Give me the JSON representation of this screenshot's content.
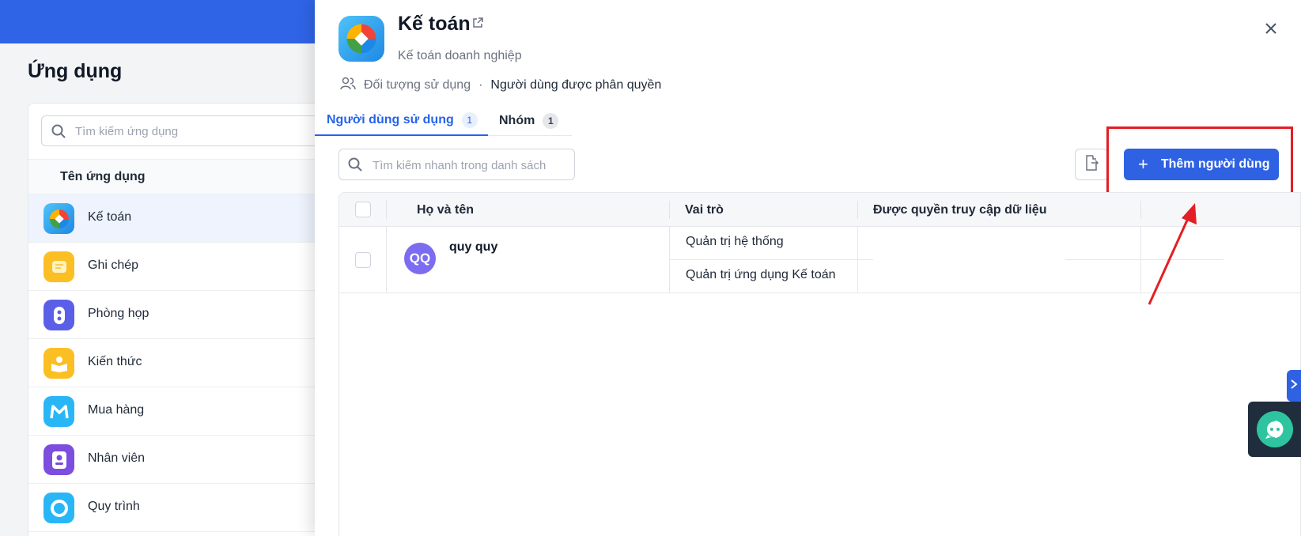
{
  "background_page": {
    "title": "Ứng dụng",
    "search_placeholder": "Tìm kiếm ứng dụng",
    "column_header": "Tên ứng dụng",
    "apps": [
      {
        "label": "Kế toán",
        "icon": "accounting-icon",
        "color": "#2196f3",
        "selected": true
      },
      {
        "label": "Ghi chép",
        "icon": "notes-icon",
        "color": "#fbbf24"
      },
      {
        "label": "Phòng họp",
        "icon": "meeting-room-icon",
        "color": "#5b5fe8"
      },
      {
        "label": "Kiến thức",
        "icon": "knowledge-icon",
        "color": "#fbbf24"
      },
      {
        "label": "Mua hàng",
        "icon": "purchase-icon",
        "color": "#29b6f6"
      },
      {
        "label": "Nhân viên",
        "icon": "employee-icon",
        "color": "#7c4ddf"
      },
      {
        "label": "Quy trình",
        "icon": "workflow-icon",
        "color": "#29b6f6"
      }
    ]
  },
  "drawer": {
    "title": "Kế toán",
    "subtitle": "Kế toán doanh nghiệp",
    "audience_label": "Đối tượng sử dụng",
    "audience_value": "Người dùng được phân quyền",
    "tabs": [
      {
        "label": "Người dùng sử dụng",
        "count": "1",
        "active": true
      },
      {
        "label": "Nhóm",
        "count": "1",
        "active": false
      }
    ],
    "search_placeholder": "Tìm kiếm nhanh trong danh sách",
    "add_button_label": "Thêm người dùng",
    "table": {
      "columns": [
        "Họ và tên",
        "Vai trò",
        "Được quyền truy cập dữ liệu"
      ],
      "rows": [
        {
          "initials": "QQ",
          "name": "quy quy",
          "roles": [
            "Quản trị hệ thống",
            "Quản trị ứng dụng Kế toán"
          ],
          "data_access": ""
        }
      ]
    }
  },
  "colors": {
    "primary": "#2f62e3",
    "annotation": "#e31e24",
    "avatar": "#7b6cf0"
  }
}
